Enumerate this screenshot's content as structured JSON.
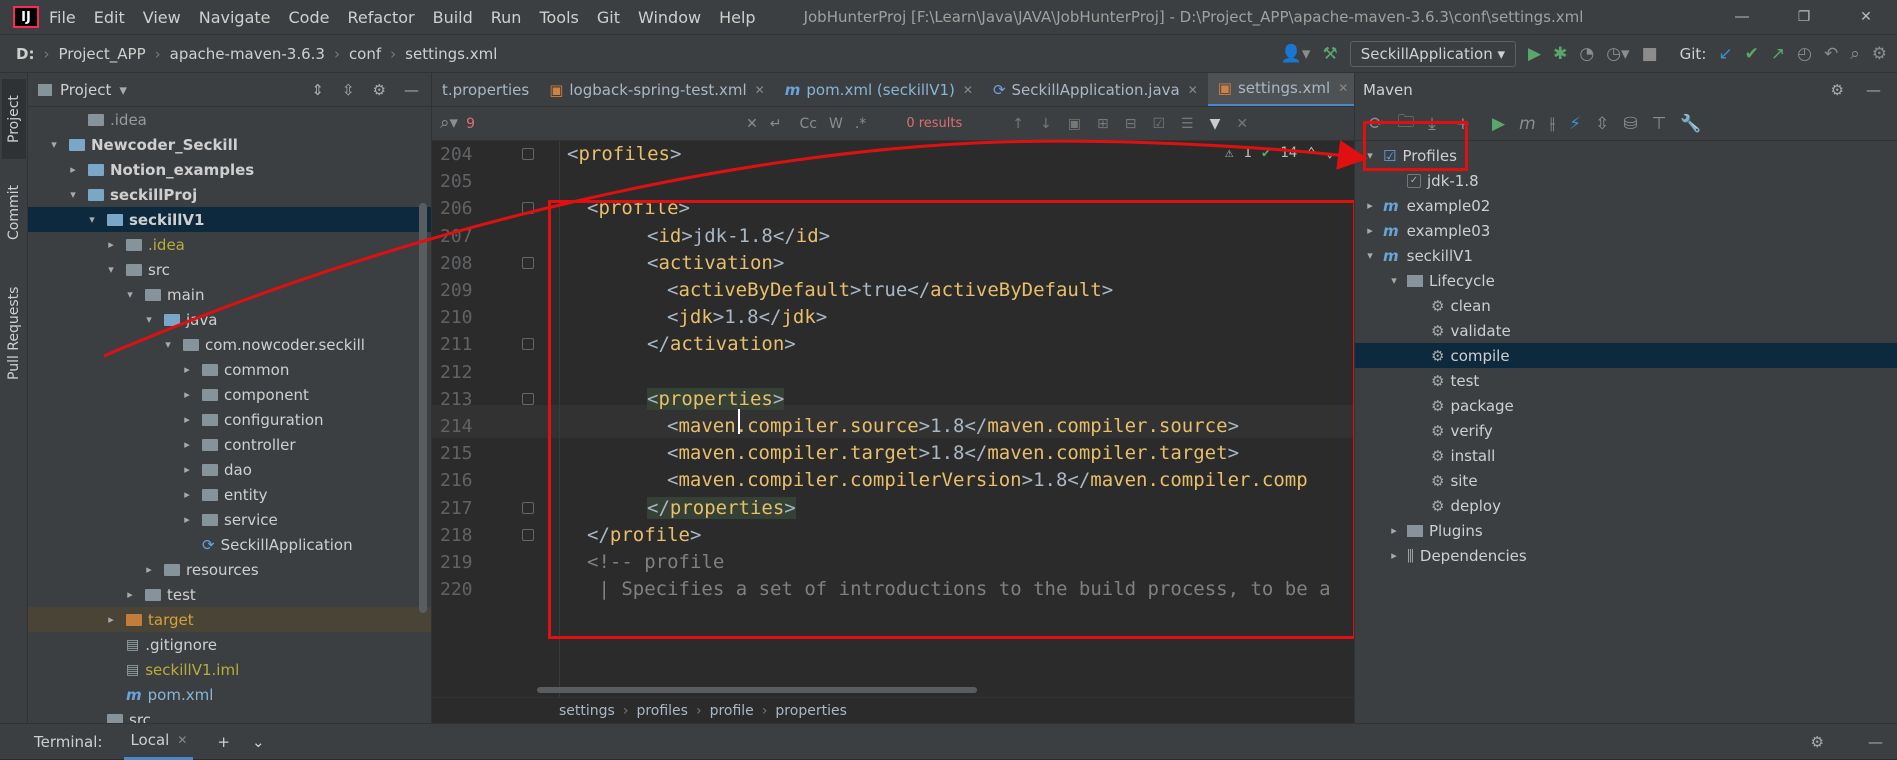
{
  "menubar": {
    "logo": "IJ",
    "items": [
      "File",
      "Edit",
      "View",
      "Navigate",
      "Code",
      "Refactor",
      "Build",
      "Run",
      "Tools",
      "Git",
      "Window",
      "Help"
    ],
    "title": "JobHunterProj [F:\\Learn\\Java\\JAVA\\JobHunterProj] - D:\\Project_APP\\apache-maven-3.6.3\\conf\\settings.xml"
  },
  "navbar": {
    "crumbs": [
      "D:",
      "Project_APP",
      "apache-maven-3.6.3",
      "conf",
      "settings.xml"
    ],
    "run_config": "SeckillApplication",
    "git_label": "Git:"
  },
  "stripe": {
    "project": "Project",
    "commit": "Commit",
    "pull": "Pull Requests"
  },
  "project": {
    "title": "Project",
    "rows": [
      {
        "label": ".idea",
        "indent": 2,
        "arrow": "",
        "icon": "folder",
        "style": "gray"
      },
      {
        "label": "Newcoder_Seckill",
        "indent": 1,
        "arrow": "▾",
        "icon": "folder-blue",
        "style": "bold"
      },
      {
        "label": "Notion_examples",
        "indent": 2,
        "arrow": "▸",
        "icon": "folder-blue",
        "style": "bold"
      },
      {
        "label": "seckillProj",
        "indent": 2,
        "arrow": "▾",
        "icon": "folder-blue",
        "style": "bold"
      },
      {
        "label": "seckillV1",
        "indent": 3,
        "arrow": "▾",
        "icon": "folder-blue",
        "style": "bold-sel"
      },
      {
        "label": ".idea",
        "indent": 4,
        "arrow": "▸",
        "icon": "folder",
        "style": "yellow"
      },
      {
        "label": "src",
        "indent": 4,
        "arrow": "▾",
        "icon": "folder",
        "style": ""
      },
      {
        "label": "main",
        "indent": 5,
        "arrow": "▾",
        "icon": "folder",
        "style": ""
      },
      {
        "label": "java",
        "indent": 6,
        "arrow": "▾",
        "icon": "folder-blue",
        "style": ""
      },
      {
        "label": "com.nowcoder.seckill",
        "indent": 7,
        "arrow": "▾",
        "icon": "folder",
        "style": ""
      },
      {
        "label": "common",
        "indent": 8,
        "arrow": "▸",
        "icon": "folder",
        "style": ""
      },
      {
        "label": "component",
        "indent": 8,
        "arrow": "▸",
        "icon": "folder",
        "style": ""
      },
      {
        "label": "configuration",
        "indent": 8,
        "arrow": "▸",
        "icon": "folder",
        "style": ""
      },
      {
        "label": "controller",
        "indent": 8,
        "arrow": "▸",
        "icon": "folder",
        "style": ""
      },
      {
        "label": "dao",
        "indent": 8,
        "arrow": "▸",
        "icon": "folder",
        "style": ""
      },
      {
        "label": "entity",
        "indent": 8,
        "arrow": "▸",
        "icon": "folder",
        "style": ""
      },
      {
        "label": "service",
        "indent": 8,
        "arrow": "▸",
        "icon": "folder",
        "style": ""
      },
      {
        "label": "SeckillApplication",
        "indent": 8,
        "arrow": "",
        "icon": "spring",
        "style": ""
      },
      {
        "label": "resources",
        "indent": 6,
        "arrow": "▸",
        "icon": "folder",
        "style": ""
      },
      {
        "label": "test",
        "indent": 5,
        "arrow": "▸",
        "icon": "folder",
        "style": ""
      },
      {
        "label": "target",
        "indent": 4,
        "arrow": "▸",
        "icon": "folder-orange",
        "style": "orange-hl"
      },
      {
        "label": ".gitignore",
        "indent": 4,
        "arrow": "",
        "icon": "file",
        "style": ""
      },
      {
        "label": "seckillV1.iml",
        "indent": 4,
        "arrow": "",
        "icon": "file",
        "style": "yel"
      },
      {
        "label": "pom.xml",
        "indent": 4,
        "arrow": "",
        "icon": "maven",
        "style": "bluet"
      },
      {
        "label": "src",
        "indent": 3,
        "arrow": "",
        "icon": "folder",
        "style": ""
      }
    ]
  },
  "editor": {
    "tabs": [
      {
        "label": "t.properties",
        "active": false
      },
      {
        "label": "logback-spring-test.xml",
        "active": false
      },
      {
        "label": "pom.xml (seckillV1)",
        "active": false
      },
      {
        "label": "SeckillApplication.java",
        "active": false
      },
      {
        "label": "settings.xml",
        "active": true
      }
    ],
    "find": {
      "query": "9",
      "results": "0 results"
    },
    "inspections": {
      "warnings": "1",
      "ok": "14"
    },
    "lines": [
      {
        "num": "204",
        "indent": 0,
        "html": "<span class=\"br\">&lt;</span><span class=\"tg\">profiles</span><span class=\"br\">&gt;</span>"
      },
      {
        "num": "205",
        "indent": 0,
        "html": ""
      },
      {
        "num": "206",
        "indent": 1,
        "html": "<span class=\"br\">&lt;</span><span class=\"tg\">profile</span><span class=\"br\">&gt;</span>"
      },
      {
        "num": "207",
        "indent": 3,
        "html": "<span class=\"br\">&lt;</span><span class=\"tg\">id</span><span class=\"br\">&gt;</span>jdk-1.8<span class=\"br\">&lt;/</span><span class=\"tg\">id</span><span class=\"br\">&gt;</span>"
      },
      {
        "num": "208",
        "indent": 3,
        "html": "<span class=\"br\">&lt;</span><span class=\"tg\">activation</span><span class=\"br\">&gt;</span>"
      },
      {
        "num": "209",
        "indent": 4,
        "html": "<span class=\"br\">&lt;</span><span class=\"tg\">activeByDefault</span><span class=\"br\">&gt;</span>true<span class=\"br\">&lt;/</span><span class=\"tg\">activeByDefault</span><span class=\"br\">&gt;</span>"
      },
      {
        "num": "210",
        "indent": 4,
        "html": "<span class=\"br\">&lt;</span><span class=\"tg\">jdk</span><span class=\"br\">&gt;</span>1.8<span class=\"br\">&lt;/</span><span class=\"tg\">jdk</span><span class=\"br\">&gt;</span>"
      },
      {
        "num": "211",
        "indent": 3,
        "html": "<span class=\"br\">&lt;/</span><span class=\"tg\">activation</span><span class=\"br\">&gt;</span>"
      },
      {
        "num": "212",
        "indent": 0,
        "html": ""
      },
      {
        "num": "213",
        "indent": 3,
        "html": "<span class=\"prophl\"><span class=\"br\">&lt;</span><span class=\"tg\">properties</span><span class=\"br\">&gt;</span></span>"
      },
      {
        "num": "214",
        "indent": 4,
        "html": "<span class=\"br\">&lt;</span><span class=\"tg\">maven.compiler.source</span><span class=\"br\">&gt;</span>1.8<span class=\"br\">&lt;/</span><span class=\"tg\">maven.compiler.source</span><span class=\"br\">&gt;</span>"
      },
      {
        "num": "215",
        "indent": 4,
        "html": "<span class=\"br\">&lt;</span><span class=\"tg\">maven.compiler.target</span><span class=\"br\">&gt;</span>1.8<span class=\"br\">&lt;/</span><span class=\"tg\">maven.compiler.target</span><span class=\"br\">&gt;</span>"
      },
      {
        "num": "216",
        "indent": 4,
        "html": "<span class=\"br\">&lt;</span><span class=\"tg\">maven.compiler.compilerVersion</span><span class=\"br\">&gt;</span>1.8<span class=\"br\">&lt;/</span><span class=\"tg\">maven.compiler.comp</span>"
      },
      {
        "num": "217",
        "indent": 3,
        "html": "<span class=\"prophl\"><span class=\"br\">&lt;/</span><span class=\"tg\">properties</span><span class=\"br\">&gt;</span></span>"
      },
      {
        "num": "218",
        "indent": 1,
        "html": "<span class=\"br\">&lt;/</span><span class=\"tg\">profile</span><span class=\"br\">&gt;</span>"
      },
      {
        "num": "219",
        "indent": 1,
        "html": "<span class=\"cm\">&lt;!-- profile</span>"
      },
      {
        "num": "220",
        "indent": 1,
        "html": "<span class=\"cm\"> | Specifies a set of introductions to the build process, to be a</span>"
      }
    ],
    "breadcrumbs": [
      "settings",
      "profiles",
      "profile",
      "properties"
    ]
  },
  "maven": {
    "title": "Maven",
    "rows": [
      {
        "label": "Profiles",
        "indent": 0,
        "arrow": "▾",
        "type": "profiles"
      },
      {
        "label": "jdk-1.8",
        "indent": 1,
        "arrow": "",
        "type": "check"
      },
      {
        "label": "example02",
        "indent": 0,
        "arrow": "▸",
        "type": "module"
      },
      {
        "label": "example03",
        "indent": 0,
        "arrow": "▸",
        "type": "module"
      },
      {
        "label": "seckillV1",
        "indent": 0,
        "arrow": "▾",
        "type": "module"
      },
      {
        "label": "Lifecycle",
        "indent": 1,
        "arrow": "▾",
        "type": "folder"
      },
      {
        "label": "clean",
        "indent": 2,
        "arrow": "",
        "type": "gear"
      },
      {
        "label": "validate",
        "indent": 2,
        "arrow": "",
        "type": "gear"
      },
      {
        "label": "compile",
        "indent": 2,
        "arrow": "",
        "type": "gear-sel"
      },
      {
        "label": "test",
        "indent": 2,
        "arrow": "",
        "type": "gear"
      },
      {
        "label": "package",
        "indent": 2,
        "arrow": "",
        "type": "gear"
      },
      {
        "label": "verify",
        "indent": 2,
        "arrow": "",
        "type": "gear"
      },
      {
        "label": "install",
        "indent": 2,
        "arrow": "",
        "type": "gear"
      },
      {
        "label": "site",
        "indent": 2,
        "arrow": "",
        "type": "gear"
      },
      {
        "label": "deploy",
        "indent": 2,
        "arrow": "",
        "type": "gear"
      },
      {
        "label": "Plugins",
        "indent": 1,
        "arrow": "▸",
        "type": "folder"
      },
      {
        "label": "Dependencies",
        "indent": 1,
        "arrow": "▸",
        "type": "deps"
      }
    ]
  },
  "terminal": {
    "label": "Terminal:",
    "tab": "Local"
  },
  "colors": {
    "annotation": "#e01010",
    "accent": "#4a88c7"
  }
}
